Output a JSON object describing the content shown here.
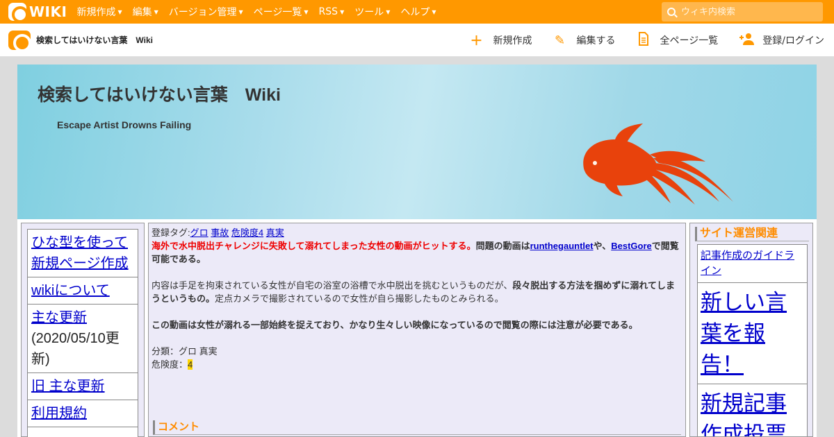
{
  "topbar": {
    "logo_text": "WIKI",
    "menu": [
      "新規作成",
      "編集",
      "バージョン管理",
      "ページ一覧",
      "RSS",
      "ツール",
      "ヘルプ"
    ],
    "search_placeholder": "ウィキ内検索"
  },
  "subbar": {
    "site_title": "検索してはいけない言葉　Wiki",
    "actions": [
      {
        "label": "新規作成",
        "icon": "plus-icon"
      },
      {
        "label": "編集する",
        "icon": "pencil-icon"
      },
      {
        "label": "全ページ一覧",
        "icon": "document-icon"
      },
      {
        "label": "登録/ログイン",
        "icon": "user-add-icon"
      }
    ]
  },
  "banner": {
    "title": "検索してはいけない言葉　Wiki",
    "subtitle": "Escape Artist Drowns Failing"
  },
  "leftnav": {
    "items": [
      {
        "label": "ひな型を使って新規ページ作成"
      },
      {
        "label": "wikiについて"
      },
      {
        "label": "主な更新",
        "note": "(2020/05/10更新)"
      },
      {
        "label": "旧 主な更新"
      },
      {
        "label": "利用規約"
      }
    ]
  },
  "main": {
    "tags_label": "登録タグ:",
    "tags": [
      "グロ",
      "事故",
      "危険度4",
      "真実"
    ],
    "p1_red": "海外で水中脱出チャレンジに失敗して溺れてしまった女性の動画がヒットする。",
    "p1_a": "問題の動画は",
    "p1_link1": "runthegauntlet",
    "p1_b": "や、",
    "p1_link2": "BestGore",
    "p1_c": "で閲覧可能である。",
    "p2_a": "内容は手足を拘束されている女性が自宅の浴室の浴槽で水中脱出を挑むというものだが、",
    "p2_bold": "段々脱出する方法を掴めずに溺れてしまうというもの。",
    "p2_c": "定点カメラで撮影されているので女性が自ら撮影したものとみられる。",
    "p3": "この動画は女性が溺れる一部始終を捉えており、かなり生々しい映像になっているので閲覧の際には注意が必要である。",
    "category_line": "分類：グロ 真実",
    "danger_label": "危険度：",
    "danger_value": "4",
    "comment_heading": "コメント"
  },
  "rightbar": {
    "heading": "サイト運営関連",
    "items": [
      {
        "label": "記事作成のガイドライン"
      },
      {
        "label": "新しい言葉を報告！"
      },
      {
        "label": "新規記事作成投票"
      }
    ]
  },
  "colors": {
    "brand_orange": "#ff9800",
    "link_blue": "#0000cc",
    "alert_red": "#ee0000",
    "panel_bg": "#eceaf8",
    "fish": "#e8420c"
  }
}
